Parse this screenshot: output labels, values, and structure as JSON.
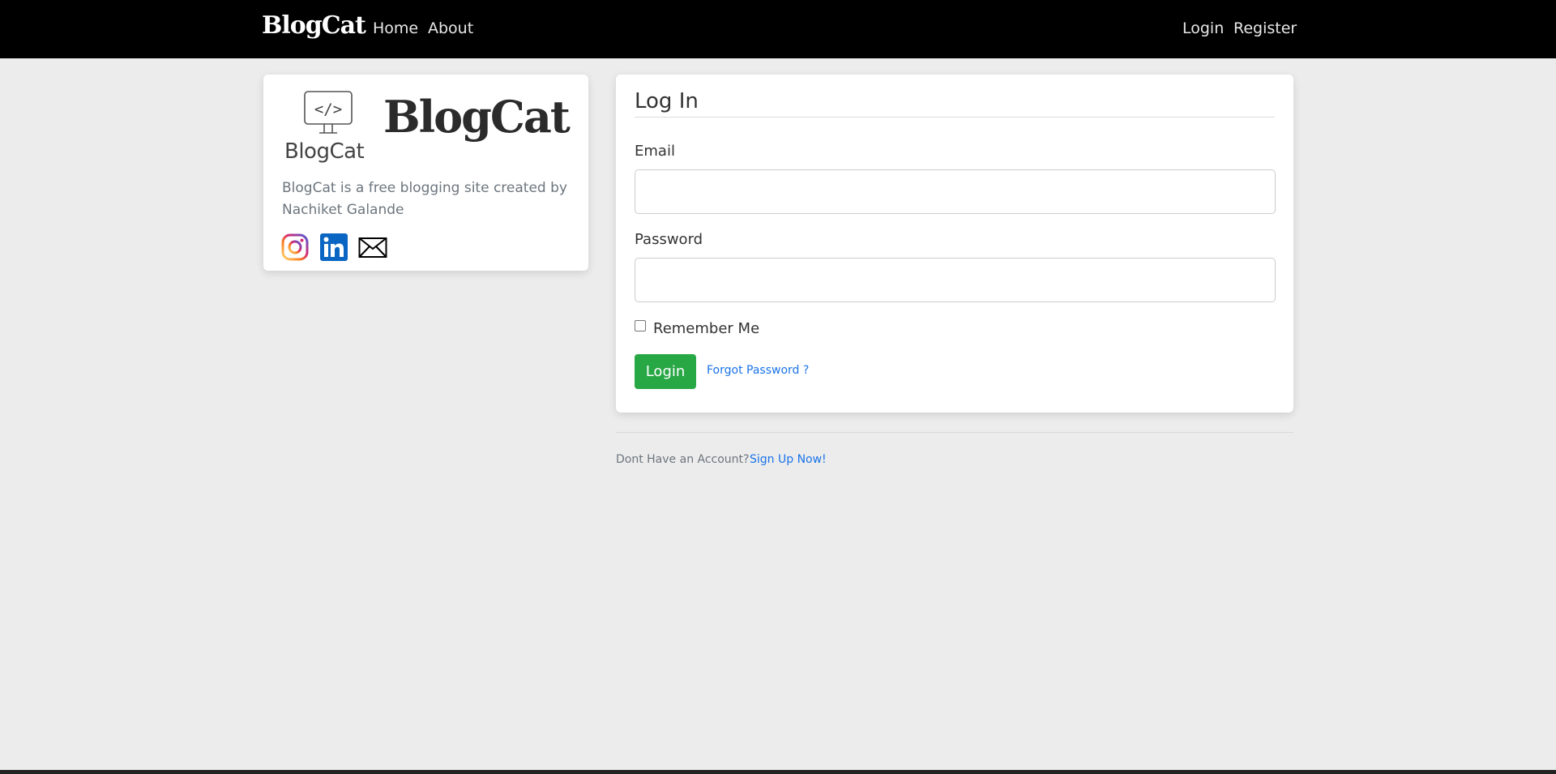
{
  "navbar": {
    "brand": "BlogCat",
    "links_left": [
      "Home",
      "About"
    ],
    "links_right": [
      "Login",
      "Register"
    ]
  },
  "sidebar": {
    "logo_caption": "BlogCat",
    "title": "BlogCat",
    "description": "BlogCat is a free blogging site created by Nachiket Galande",
    "social_icons": [
      "instagram-icon",
      "linkedin-icon",
      "mail-icon"
    ]
  },
  "login": {
    "title": "Log In",
    "email_label": "Email",
    "email_value": "",
    "password_label": "Password",
    "password_value": "",
    "remember_label": "Remember Me",
    "remember_checked": false,
    "submit_label": "Login",
    "forgot_label": "Forgot Password ?"
  },
  "footer": {
    "no_account_text": "Dont Have an Account?",
    "signup_label": "Sign Up Now!"
  },
  "colors": {
    "navbar_bg": "#000000",
    "page_bg": "#ececec",
    "button_green": "#28a745",
    "link_blue": "#1a73e8"
  }
}
